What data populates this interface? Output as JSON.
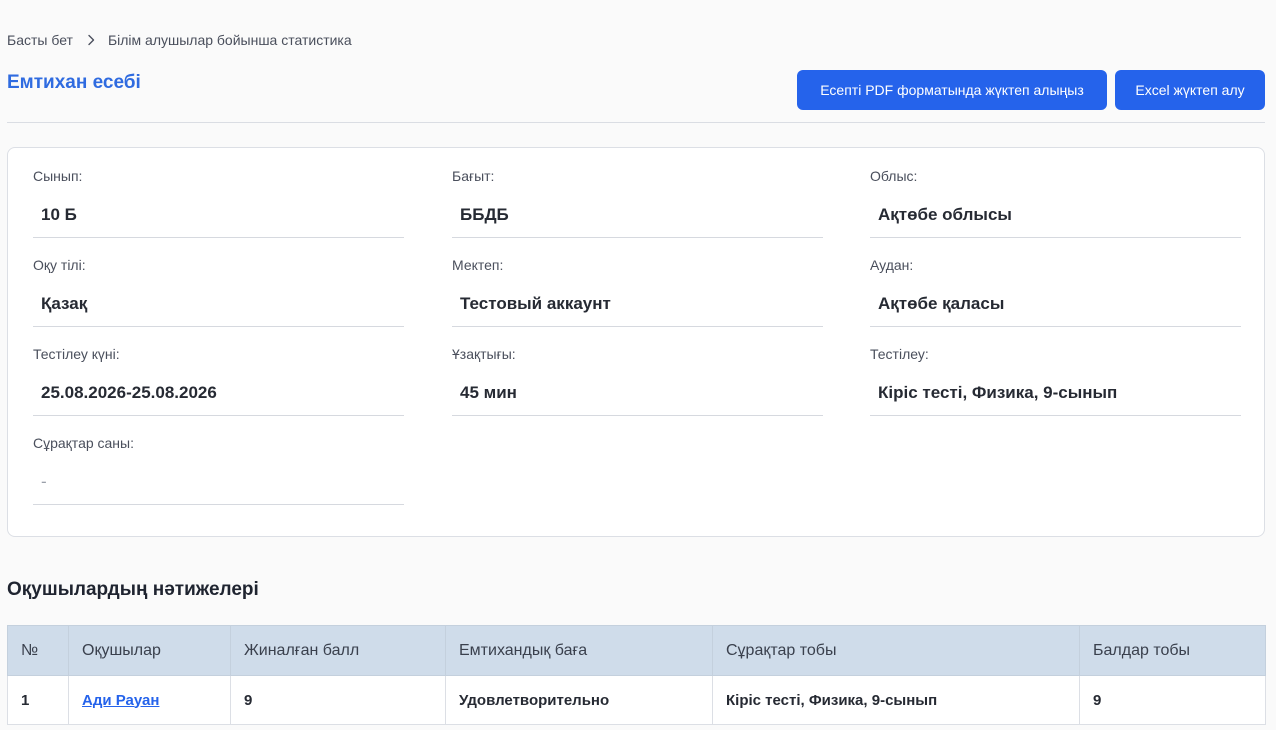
{
  "breadcrumb": {
    "home": "Басты бет",
    "current": "Білім алушылар бойынша статистика"
  },
  "header": {
    "title": "Емтихан есебі",
    "pdf_button": "Есепті PDF форматында жүктеп алыңыз",
    "excel_button": "Excel жүктеп алу"
  },
  "info": {
    "class": {
      "label": "Сынып:",
      "value": "10 Б"
    },
    "direction": {
      "label": "Бағыт:",
      "value": "ББДБ"
    },
    "region": {
      "label": "Облыс:",
      "value": "Ақтөбе облысы"
    },
    "language": {
      "label": "Оқу тілі:",
      "value": "Қазақ"
    },
    "school": {
      "label": "Мектеп:",
      "value": "Тестовый аккаунт"
    },
    "district": {
      "label": "Аудан:",
      "value": "Ақтөбе қаласы"
    },
    "test_date": {
      "label": "Тестілеу күні:",
      "value": "25.08.2026-25.08.2026"
    },
    "duration": {
      "label": "Ұзақтығы:",
      "value": "45 мин"
    },
    "testing": {
      "label": "Тестілеу:",
      "value": "Кіріс тесті, Физика, 9-сынып"
    },
    "question_count": {
      "label": "Сұрақтар саны:",
      "value": "-"
    }
  },
  "results": {
    "title": "Оқушылардың нәтижелері",
    "columns": [
      "№",
      "Оқушылар",
      "Жиналған балл",
      "Емтихандық баға",
      "Сұрақтар тобы",
      "Балдар тобы"
    ],
    "rows": [
      {
        "num": "1",
        "student": "Ади Рауан",
        "score": "9",
        "grade": "Удовлетворительно",
        "question_group": "Кіріс тесті, Физика, 9-сынып",
        "score_group": "9"
      }
    ]
  }
}
